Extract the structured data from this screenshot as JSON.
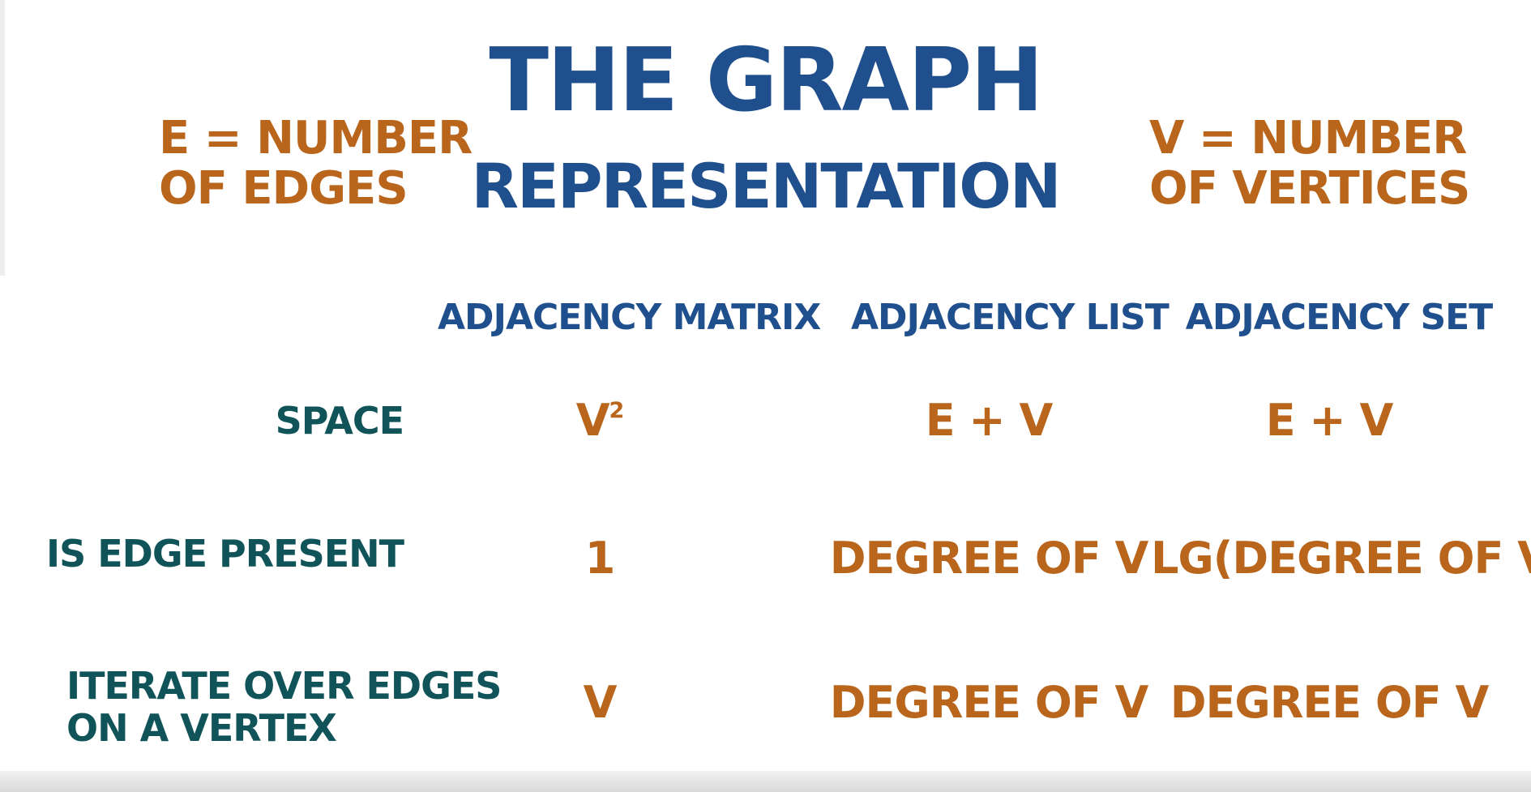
{
  "title": {
    "main": "THE GRAPH",
    "sub": "REPRESENTATION"
  },
  "definitions": {
    "edges": "E = NUMBER\nOF EDGES",
    "vertices": "V = NUMBER\nOF VERTICES"
  },
  "table": {
    "columns": [
      "ADJACENCY MATRIX",
      "ADJACENCY LIST",
      "ADJACENCY SET"
    ],
    "rows": [
      {
        "label": "SPACE",
        "cells": [
          {
            "base": "V",
            "sup": "2"
          },
          {
            "base": "E + V",
            "sup": ""
          },
          {
            "base": "E + V",
            "sup": ""
          }
        ]
      },
      {
        "label": "IS EDGE PRESENT",
        "cells": [
          {
            "base": "1",
            "sup": ""
          },
          {
            "base": "DEGREE OF V",
            "sup": ""
          },
          {
            "base": "LG(DEGREE OF V)",
            "sup": ""
          }
        ]
      },
      {
        "label": "ITERATE OVER EDGES\nON A VERTEX",
        "cells": [
          {
            "base": "V",
            "sup": ""
          },
          {
            "base": "DEGREE OF V",
            "sup": ""
          },
          {
            "base": "DEGREE OF V",
            "sup": ""
          }
        ]
      }
    ]
  },
  "colors": {
    "title": "#1f4f8d",
    "value": "#b9651b",
    "row_label": "#10545a",
    "background": "#ffffff"
  }
}
